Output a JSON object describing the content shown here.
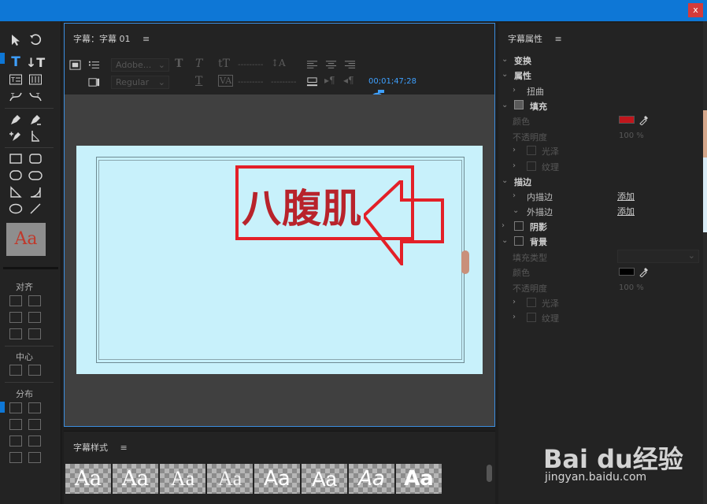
{
  "window": {
    "close_label": "x",
    "accent_color": "#0e77d6"
  },
  "tools": {
    "style_swatch_text": "Aa",
    "align_label": "对齐",
    "center_label": "中心",
    "distribute_label": "分布"
  },
  "title_panel": {
    "header": "字幕：字幕 01",
    "menu_icon": "≡",
    "font_family_dropdown": "Adobe...",
    "font_style_dropdown": "Regular",
    "timecode": "00;01;47;28"
  },
  "canvas": {
    "title_text": "八腹肌",
    "title_color": "#b8232b",
    "annotation_color": "#e32028"
  },
  "styles_panel": {
    "header": "字幕样式",
    "menu_icon": "≡",
    "tiles": [
      "Aa",
      "Aa",
      "Aa",
      "Aa",
      "Aa",
      "Aa",
      "Aa",
      "Aa"
    ]
  },
  "props_panel": {
    "header": "字幕属性",
    "menu_icon": "≡",
    "transform": "变换",
    "properties": "属性",
    "distort": "扭曲",
    "fill": "填充",
    "fill_color_label": "颜色",
    "fill_color": "#c0161c",
    "fill_opacity_label": "不透明度",
    "fill_opacity_value": "100 %",
    "sheen": "光泽",
    "texture": "纹理",
    "strokes": "描边",
    "inner_stroke": "内描边",
    "inner_stroke_add": "添加",
    "outer_stroke": "外描边",
    "outer_stroke_add": "添加",
    "shadow": "阴影",
    "background": "背景",
    "fill_type_label": "填充类型",
    "bg_color_label": "颜色",
    "bg_color": "#000000",
    "bg_opacity_label": "不透明度",
    "bg_opacity_value": "100 %",
    "bg_sheen": "光泽",
    "bg_texture": "纹理"
  },
  "watermark": {
    "brand": "Bai du经验",
    "url": "jingyan.baidu.com"
  }
}
